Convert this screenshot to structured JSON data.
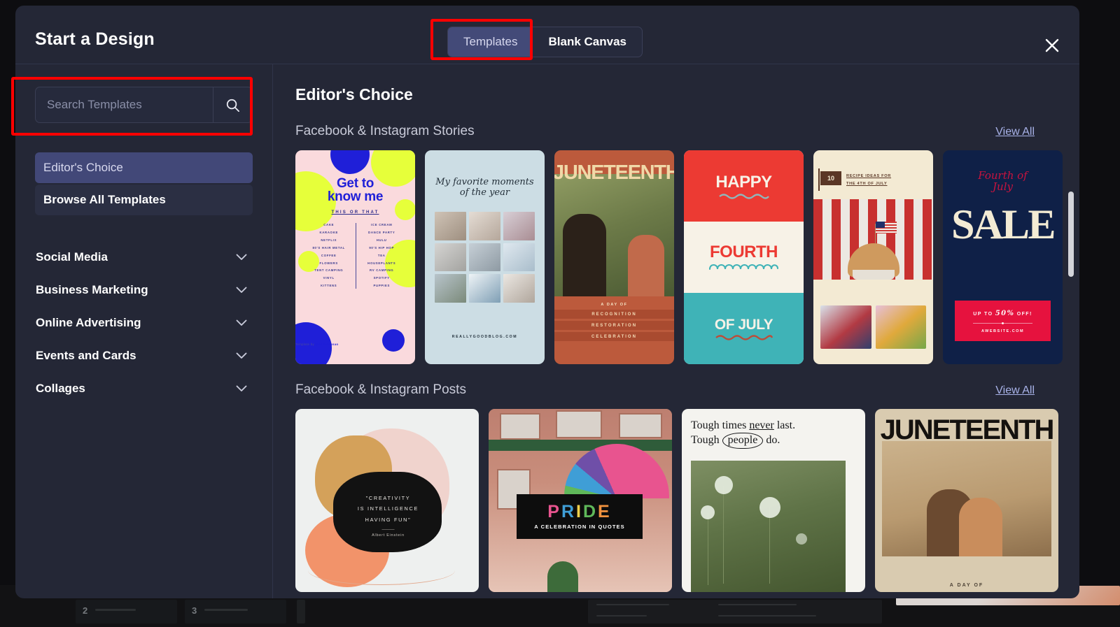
{
  "modal": {
    "title": "Start a Design",
    "close_label": "×",
    "tabs": [
      {
        "label": "Templates",
        "active": true
      },
      {
        "label": "Blank Canvas",
        "active": false
      }
    ]
  },
  "sidebar": {
    "search": {
      "placeholder": "Search Templates",
      "value": "",
      "icon": "search-icon"
    },
    "quick_items": [
      {
        "label": "Editor's Choice",
        "active": true
      },
      {
        "label": "Browse All Templates",
        "active": false
      }
    ],
    "categories": [
      {
        "label": "Social Media",
        "chevron": "chevron-down-icon"
      },
      {
        "label": "Business Marketing",
        "chevron": "chevron-down-icon"
      },
      {
        "label": "Online Advertising",
        "chevron": "chevron-down-icon"
      },
      {
        "label": "Events and Cards",
        "chevron": "chevron-down-icon"
      },
      {
        "label": "Collages",
        "chevron": "chevron-down-icon"
      }
    ]
  },
  "main": {
    "heading": "Editor's Choice",
    "sections": [
      {
        "title": "Facebook & Instagram Stories",
        "view_all": "View All",
        "cards": [
          {
            "name": "get-to-know-me",
            "title_line1": "Get to",
            "title_line2": "know me",
            "subtitle": "THIS OR THAT",
            "left_options": [
              "CAKE",
              "KARAOKE",
              "NETFLIX",
              "80'S HAIR METAL",
              "COFFEE",
              "FLOWERS",
              "TENT CAMPING",
              "VINYL",
              "KITTENS"
            ],
            "right_options": [
              "ICE CREAM",
              "DANCE PARTY",
              "HULU",
              "90'S HIP HOP",
              "TEA",
              "HOUSEPLANTS",
              "RV CAMPING",
              "SPOTIFY",
              "PUPPIES"
            ],
            "footer_prefix": "Template by ",
            "footer_handle": "@beforefusao"
          },
          {
            "name": "favorite-moments",
            "title_line1": "My favorite moments",
            "title_line2": "of the year",
            "url": "REALLYGOODBLOG.COM"
          },
          {
            "name": "juneteenth-story",
            "title": "JUNETEENTH",
            "day_of": "A DAY OF",
            "bars": [
              "RECOGNITION",
              "RESTORATION",
              "CELEBRATION"
            ]
          },
          {
            "name": "happy-fourth-of-july",
            "word1": "HAPPY",
            "word2": "FOURTH",
            "word3": "OF JULY"
          },
          {
            "name": "recipe-ideas-fourth",
            "badge": "10",
            "line1": "RECIPE IDEAS FOR",
            "line2": "THE 4TH OF JULY"
          },
          {
            "name": "fourth-of-july-sale",
            "script_line1": "Fourth of",
            "script_line2": "July",
            "sale": "SALE",
            "offer_prefix": "UP TO ",
            "offer_amount": "50%",
            "offer_suffix": " OFF!",
            "url": "AWEBSITE.COM"
          }
        ]
      },
      {
        "title": "Facebook & Instagram Posts",
        "view_all": "View All",
        "cards": [
          {
            "name": "creativity-quote",
            "quote_line1": "\"CREATIVITY",
            "quote_line2": "IS INTELLIGENCE",
            "quote_line3": "HAVING FUN\"",
            "dash": "———",
            "author": "Albert Einstein"
          },
          {
            "name": "pride-celebration",
            "letters": [
              {
                "char": "P",
                "color": "#e8548f"
              },
              {
                "char": "R",
                "color": "#3f9ed6"
              },
              {
                "char": "I",
                "color": "#f2d14b"
              },
              {
                "char": "D",
                "color": "#5fb85a"
              },
              {
                "char": "E",
                "color": "#f1923e"
              }
            ],
            "subtitle": "A CELEBRATION IN QUOTES"
          },
          {
            "name": "tough-times-quote",
            "line1_a": "Tough times ",
            "line1_underlined": "never",
            "line1_b": " last.",
            "line2_a": "Tough ",
            "line2_circled": "people",
            "line2_b": " do."
          },
          {
            "name": "juneteenth-post",
            "title": "JUNETEENTH",
            "footer": "A DAY OF"
          }
        ]
      }
    ]
  },
  "scrollbar": {
    "name": "vertical-scrollbar"
  },
  "colors": {
    "modal_bg": "#242736",
    "accent_purple": "#434a78",
    "link": "#a8b2e8",
    "annotation_red": "#fe0000"
  }
}
